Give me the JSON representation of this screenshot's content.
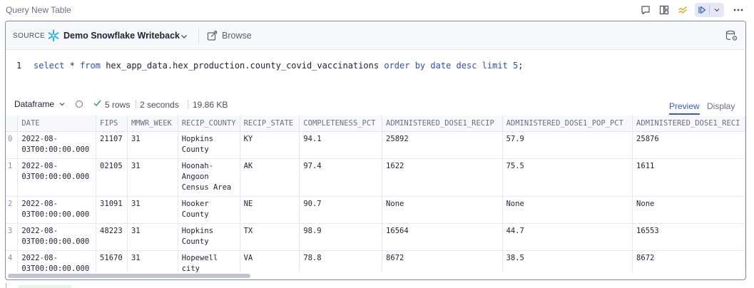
{
  "cell": {
    "title": "Query New Table"
  },
  "source": {
    "label": "SOURCE",
    "name": "Demo Snowflake Writeback",
    "browse_label": "Browse"
  },
  "editor": {
    "line_number": "1",
    "query_parts": {
      "select": "select",
      "star": "*",
      "from": "from",
      "table": "hex_app_data.hex_production.county_covid_vaccinations",
      "order": "order",
      "by": "by",
      "column": "date",
      "desc": "desc",
      "limit": "limit",
      "limit_value": "5",
      "end": ";"
    }
  },
  "result": {
    "output_type": "Dataframe",
    "rows": "5 rows",
    "duration": "2 seconds",
    "size": "19.86 KB",
    "tabs": [
      "Preview",
      "Display"
    ],
    "active_tab": "Preview"
  },
  "table": {
    "columns": [
      "DATE",
      "FIPS",
      "MMWR_WEEK",
      "RECIP_COUNTY",
      "RECIP_STATE",
      "COMPLETENESS_PCT",
      "ADMINISTERED_DOSE1_RECIP",
      "ADMINISTERED_DOSE1_POP_PCT",
      "ADMINISTERED_DOSE1_RECI"
    ],
    "rows": [
      {
        "index": "0",
        "cells": [
          "2022-08-03T00:00:00.000",
          "21107",
          "31",
          "Hopkins County",
          "KY",
          "94.1",
          "25892",
          "57.9",
          "25876"
        ]
      },
      {
        "index": "1",
        "cells": [
          "2022-08-03T00:00:00.000",
          "02105",
          "31",
          "Hoonah-Angoon Census Area",
          "AK",
          "97.4",
          "1622",
          "75.5",
          "1611"
        ]
      },
      {
        "index": "2",
        "cells": [
          "2022-08-03T00:00:00.000",
          "31091",
          "31",
          "Hooker County",
          "NE",
          "90.7",
          "None",
          "None",
          "None"
        ]
      },
      {
        "index": "3",
        "cells": [
          "2022-08-03T00:00:00.000",
          "48223",
          "31",
          "Hopkins County",
          "TX",
          "98.9",
          "16564",
          "44.7",
          "16553"
        ]
      },
      {
        "index": "4",
        "cells": [
          "2022-08-03T00:00:00.000",
          "51670",
          "31",
          "Hopewell city",
          "VA",
          "78.8",
          "8672",
          "38.5",
          "8672"
        ]
      }
    ]
  },
  "icons": {
    "top_bar": [
      "comment-icon",
      "layout-icon",
      "chart-sparkle-icon",
      "run-icon",
      "chevron-down-icon",
      "more-icon"
    ],
    "source": [
      "snowflake-icon",
      "chevron-down-icon",
      "browse-icon",
      "database-settings-icon"
    ]
  },
  "colors": {
    "accent": "#3b57c4",
    "keyword": "#2a4fc0",
    "snowflake": "#29b5e8",
    "success": "#3a9c56",
    "sparkle": "#d9a520"
  }
}
